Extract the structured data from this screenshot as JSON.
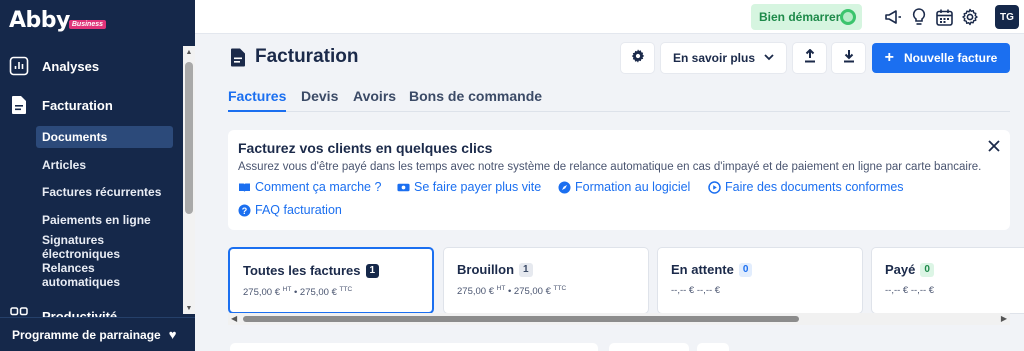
{
  "brand": {
    "logo_text": "Abby",
    "logo_badge": "Business"
  },
  "sidebar": {
    "items": [
      {
        "label": "Analyses",
        "icon": "chart-icon"
      },
      {
        "label": "Facturation",
        "icon": "document-icon"
      }
    ],
    "sub_items": [
      "Documents",
      "Articles",
      "Factures récurrentes",
      "Paiements en ligne",
      "Signatures électroniques",
      "Relances automatiques"
    ],
    "partial_item": "Productivité",
    "referral": "Programme de parrainage"
  },
  "topbar": {
    "start_label": "Bien démarrer",
    "avatar": "TG"
  },
  "header": {
    "title": "Facturation",
    "learn_more": "En savoir plus",
    "new_invoice": "Nouvelle facture"
  },
  "tabs": [
    {
      "label": "Factures",
      "active": true
    },
    {
      "label": "Devis",
      "active": false
    },
    {
      "label": "Avoirs",
      "active": false
    },
    {
      "label": "Bons de commande",
      "active": false
    }
  ],
  "banner": {
    "title": "Facturez vos clients en quelques clics",
    "description": "Assurez vous d'être payé dans les temps avec notre système de relance automatique en cas d'impayé et de paiement en ligne par carte bancaire.",
    "links": [
      "Comment ça marche ?",
      "Se faire payer plus vite",
      "Formation au logiciel",
      "Faire des documents conformes",
      "FAQ facturation"
    ]
  },
  "status_cards": [
    {
      "title": "Toutes les factures",
      "count": "1",
      "amount_ht": "275,00 €",
      "amount_ttc": "275,00 €",
      "active": true
    },
    {
      "title": "Brouillon",
      "count": "1",
      "amount_ht": "275,00 €",
      "amount_ttc": "275,00 €",
      "active": false
    },
    {
      "title": "En attente",
      "count": "0",
      "amount_ht": "--,-- €",
      "amount_ttc": "--,-- €",
      "active": false
    },
    {
      "title": "Payé",
      "count": "0",
      "amount_ht": "--,-- €",
      "amount_ttc": "--,-- €",
      "active": false
    }
  ],
  "labels": {
    "ht": "HT",
    "ttc": "TTC",
    "sep": "•"
  },
  "colors": {
    "sidebar_bg": "#15284a",
    "primary": "#1b6ff0",
    "success": "#3bc46d"
  }
}
